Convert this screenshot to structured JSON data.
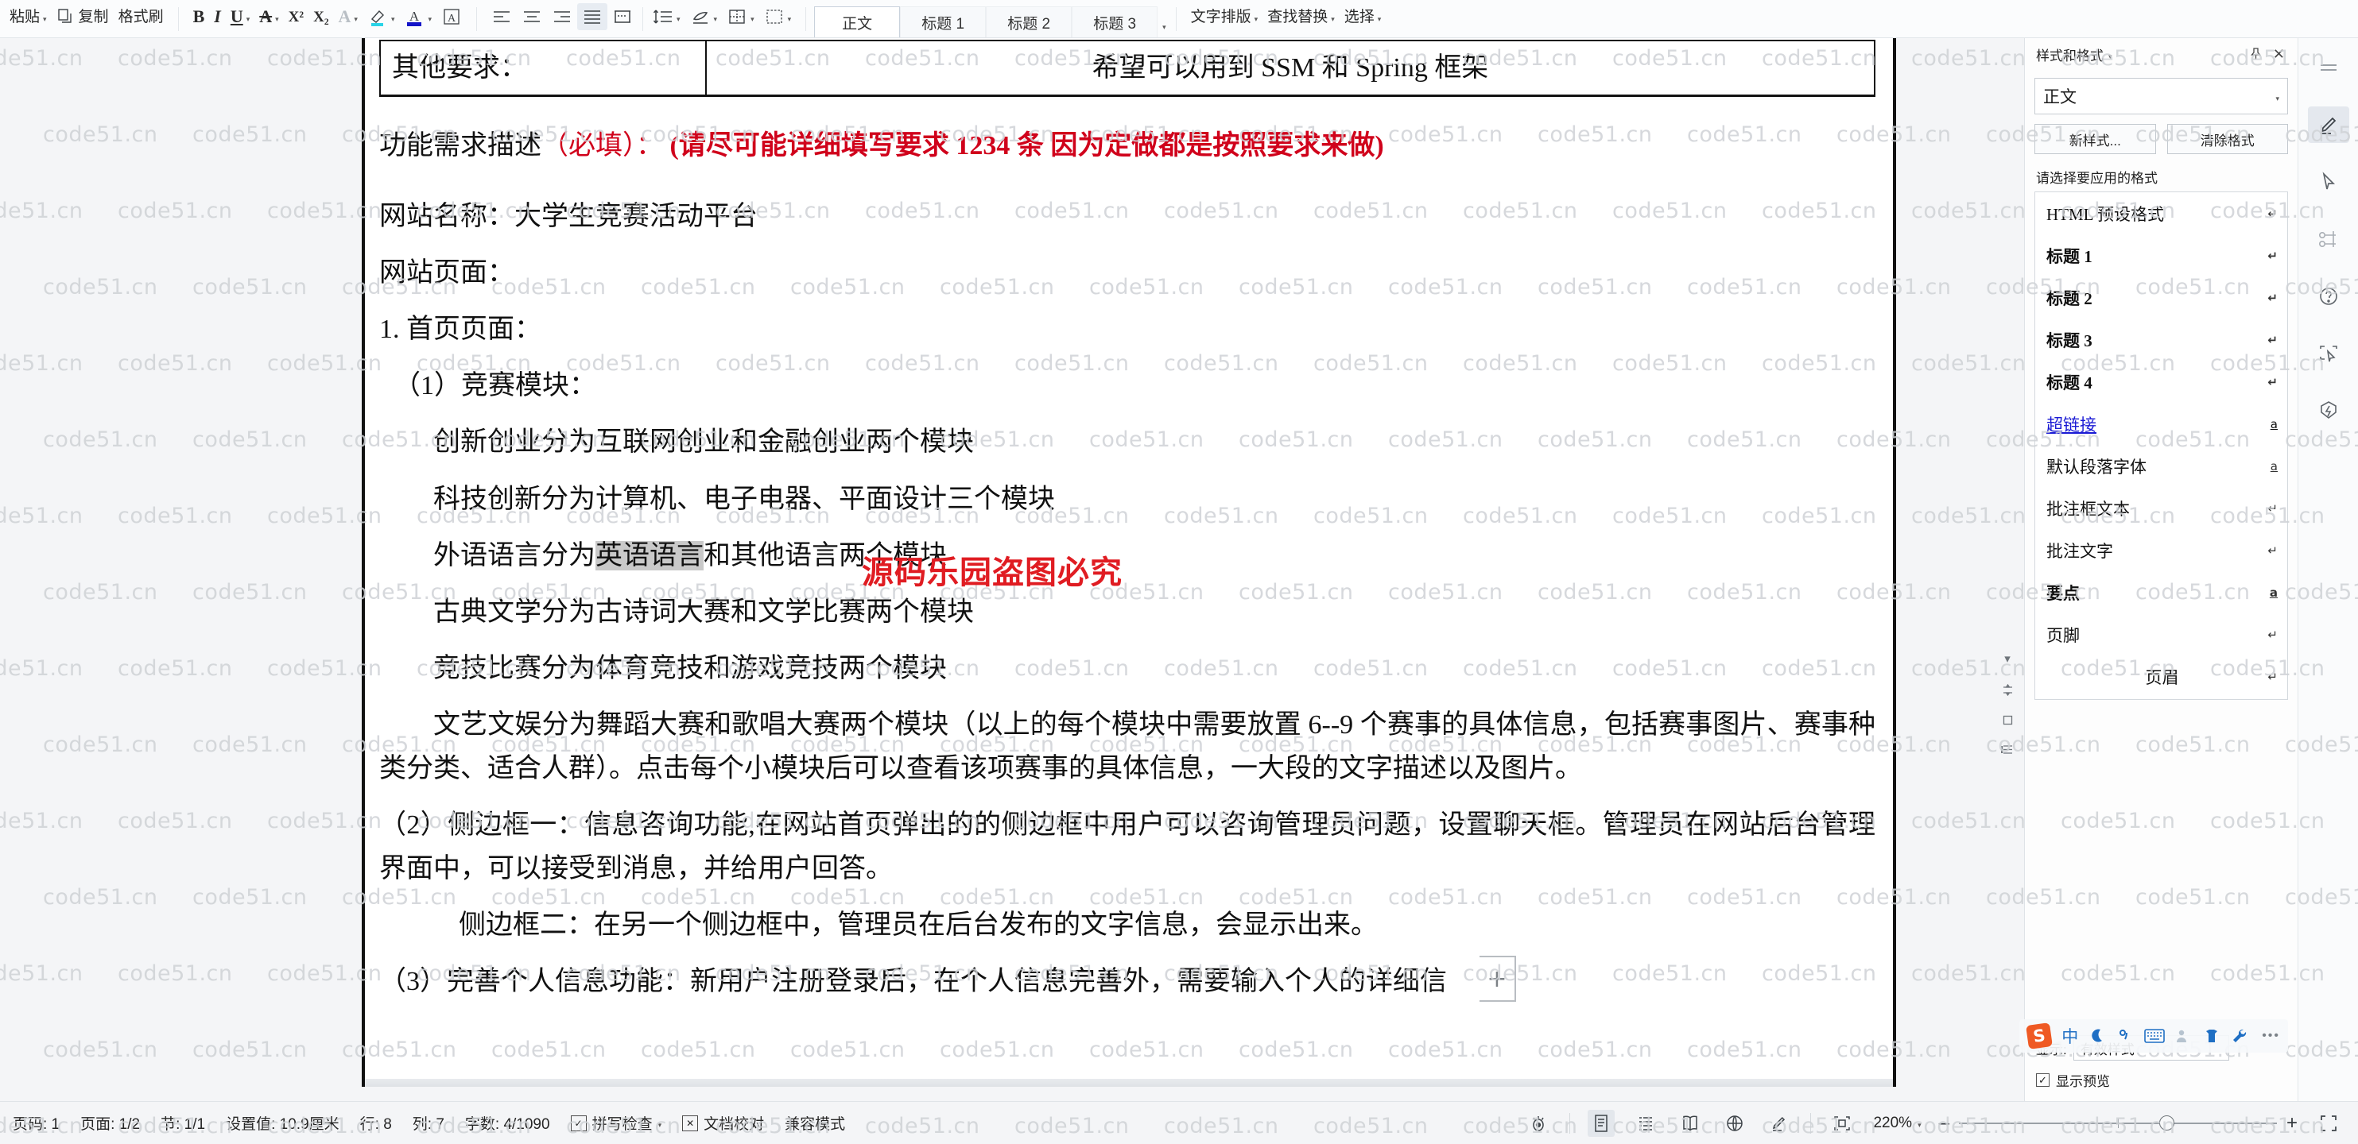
{
  "toolbar": {
    "clipboard": [
      {
        "label": "粘贴",
        "icon": "paste-icon",
        "caret": true
      },
      {
        "label": "复制",
        "icon": "copy-icon",
        "caret": false
      },
      {
        "label": "格式刷",
        "icon": "format-painter-icon",
        "caret": false
      }
    ],
    "font_buttons": [
      {
        "name": "bold",
        "glyph": "B"
      },
      {
        "name": "italic",
        "glyph": "I"
      },
      {
        "name": "underline",
        "glyph": "U",
        "caret": true
      },
      {
        "name": "strikethrough",
        "glyph": "A",
        "caret": true
      },
      {
        "name": "superscript",
        "glyph": "X²"
      },
      {
        "name": "subscript",
        "glyph": "X₂"
      },
      {
        "name": "text-effects",
        "glyph": "A",
        "caret": true
      },
      {
        "name": "highlight-color",
        "glyph": "A",
        "caret": true
      },
      {
        "name": "font-color",
        "glyph": "A",
        "caret": true
      },
      {
        "name": "character-border",
        "glyph": "A"
      }
    ],
    "paragraph_buttons": [
      {
        "name": "align-left"
      },
      {
        "name": "align-center"
      },
      {
        "name": "align-right"
      },
      {
        "name": "align-justify",
        "active": true
      },
      {
        "name": "distribute"
      },
      {
        "name": "line-spacing",
        "caret": true
      },
      {
        "name": "shading",
        "caret": true
      },
      {
        "name": "borders",
        "caret": true
      }
    ],
    "styles": [
      {
        "label": "正文",
        "selected": true
      },
      {
        "label": "标题 1",
        "selected": false
      },
      {
        "label": "标题 2",
        "selected": false
      },
      {
        "label": "标题 3",
        "selected": false
      }
    ],
    "right_tools": [
      {
        "label": "文字排版",
        "caret": true
      },
      {
        "label": "查找替换",
        "caret": true
      },
      {
        "label": "选择",
        "caret": true
      }
    ]
  },
  "document": {
    "table": {
      "label": "其他要求：",
      "value": "希望可以用到 SSM 和 Spring 框架"
    },
    "heading": {
      "black": "功能需求描述",
      "red_light": "（必填）：",
      "red_bold": "(请尽可能详细填写要求 1234 条  因为定做都是按照要求来做)"
    },
    "lines": [
      {
        "text": "网站名称：大学生竞赛活动平台",
        "indent": 1
      },
      {
        "text": "网站页面：",
        "indent": 1
      },
      {
        "text": "1.  首页页面：",
        "indent": 1
      },
      {
        "text": "（1）竞赛模块：",
        "indent": 1
      },
      {
        "text": "创新创业分为互联网创业和金融创业两个模块",
        "indent": 2
      },
      {
        "text": "科技创新分为计算机、电子电器、平面设计三个模块",
        "indent": 2
      }
    ],
    "selected_line": {
      "prefix": "外语语言分为",
      "selection": "英语语言",
      "suffix": "和其他语言两个模块",
      "indent": 2
    },
    "lines2": [
      {
        "text": "古典文学分为古诗词大赛和文学比赛两个模块",
        "indent": 2
      },
      {
        "text": "竞技比赛分为体育竞技和游戏竞技两个模块",
        "indent": 2
      }
    ],
    "para_wrap": "文艺文娱分为舞蹈大赛和歌唱大赛两个模块（以上的每个模块中需要放置 6--9 个赛事的具体信息，包括赛事图片、赛事种类分类、适合人群）。点击每个小模块后可以查看该项赛事的具体信息，一大段的文字描述以及图片。",
    "para_2": "（2）侧边框一：信息咨询功能,在网站首页弹出的的侧边框中用户可以咨询管理员问题，设置聊天框。管理员在网站后台管理界面中，可以接受到消息，并给用户回答。",
    "para_3": "侧边框二：在另一个侧边框中，管理员在后台发布的文字信息，会显示出来。",
    "para_4": "（3）完善个人信息功能：新用户注册登录后，在个人信息完善外，需要输入个人的详细信",
    "red_watermark": "源码乐园盗图必究",
    "tile_watermark": "code51.cn"
  },
  "styles_panel": {
    "title": "样式和格式",
    "pin_icon": "pin-icon",
    "close_icon": "close-icon",
    "current_style": "正文",
    "new_style_button": "新样式...",
    "clear_format_button": "清除格式",
    "hint": "请选择要应用的格式",
    "items": [
      {
        "label": "HTML 预设格式",
        "mark": "↵",
        "bold": false,
        "link": false,
        "center": false
      },
      {
        "label": "标题 1",
        "mark": "↵",
        "bold": true,
        "link": false,
        "center": false
      },
      {
        "label": "标题 2",
        "mark": "↵",
        "bold": true,
        "link": false,
        "center": false
      },
      {
        "label": "标题 3",
        "mark": "↵",
        "bold": true,
        "link": false,
        "center": false
      },
      {
        "label": "标题 4",
        "mark": "↵",
        "bold": true,
        "link": false,
        "center": false
      },
      {
        "label": "超链接",
        "mark": "a",
        "bold": false,
        "link": true,
        "center": false
      },
      {
        "label": "默认段落字体",
        "mark": "a",
        "bold": false,
        "link": false,
        "center": false
      },
      {
        "label": "批注框文本",
        "mark": "↵",
        "bold": false,
        "link": false,
        "center": false
      },
      {
        "label": "批注文字",
        "mark": "↵",
        "bold": false,
        "link": false,
        "center": false
      },
      {
        "label": "要点",
        "mark": "a",
        "bold": true,
        "link": false,
        "center": false
      },
      {
        "label": "页脚",
        "mark": "↵",
        "bold": false,
        "link": false,
        "center": false
      },
      {
        "label": "页眉",
        "mark": "↵",
        "bold": false,
        "link": false,
        "center": true
      }
    ],
    "selected_item": {
      "label": "正文",
      "mark": "↵"
    },
    "show_label": "显示:",
    "show_value": "有效样式",
    "preview_label": "显示预览",
    "preview_checked": "☑"
  },
  "ime": {
    "logo": "S",
    "mode": "中",
    "moon_icon": "moon-icon",
    "degree_icon": "degree-icon",
    "keyboard_icon": "keyboard-icon",
    "user_icon": "user-icon",
    "skin_icon": "skin-icon",
    "wrench_icon": "wrench-icon",
    "more": "•••"
  },
  "rail": {
    "items": [
      {
        "name": "menu-lines-icon",
        "active": false
      },
      {
        "name": "highlighter-pen-icon",
        "active": true
      },
      {
        "name": "cursor-arrow-icon",
        "active": false
      },
      {
        "name": "node-connector-icon",
        "active": false
      },
      {
        "name": "help-circle-icon",
        "active": false
      },
      {
        "name": "screenshot-icon",
        "active": false
      },
      {
        "name": "ai-spark-icon",
        "active": false
      }
    ]
  },
  "status_bar": {
    "left": [
      {
        "label": "页码: 1",
        "icon": null
      },
      {
        "label": "页面: 1/2",
        "icon": null
      },
      {
        "label": "节: 1/1",
        "icon": null
      },
      {
        "label": "设置值: 10.9厘米",
        "icon": null
      },
      {
        "label": "行: 8",
        "icon": null
      },
      {
        "label": "列: 7",
        "icon": null
      },
      {
        "label": "字数: 4/1090",
        "icon": null
      },
      {
        "label": "拼写检查",
        "icon": "check-box-icon",
        "caret": true
      },
      {
        "label": "文档校对",
        "icon": "proof-box-icon"
      },
      {
        "label": "兼容模式",
        "icon": null
      }
    ],
    "right": {
      "focus_icon": "focus-eye-icon",
      "views": [
        {
          "name": "page-view-icon",
          "active": true
        },
        {
          "name": "outline-view-icon",
          "active": false
        },
        {
          "name": "reading-view-icon",
          "active": false
        },
        {
          "name": "web-view-icon",
          "active": false
        },
        {
          "name": "ink-view-icon",
          "active": false
        }
      ],
      "fit_icon": "fit-page-icon",
      "zoom_value": "220%",
      "minus": "–",
      "plus": "+",
      "fullscreen_icon": "fullscreen-icon"
    }
  },
  "colors": {
    "accent_red": "#d0021b",
    "watermark_gray": "#cfd2d6",
    "link_blue": "#1a1ad4",
    "panel_bg": "#fdfdfd",
    "chrome_bg": "#f4f5f7"
  }
}
